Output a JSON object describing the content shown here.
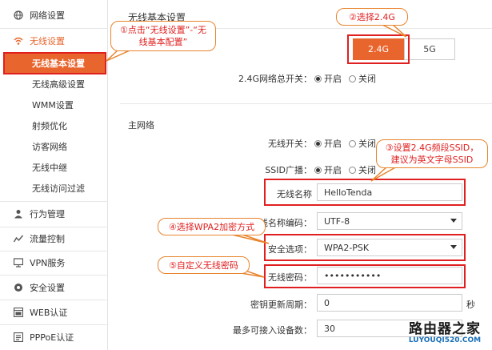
{
  "sidebar": {
    "items": [
      {
        "label": "网络设置",
        "icon": "globe-icon"
      },
      {
        "label": "无线设置",
        "icon": "wifi-icon"
      },
      {
        "label": "行为管理",
        "icon": "user-icon"
      },
      {
        "label": "流量控制",
        "icon": "chart-line-icon"
      },
      {
        "label": "VPN服务",
        "icon": "monitor-icon"
      },
      {
        "label": "安全设置",
        "icon": "shield-gear-icon"
      },
      {
        "label": "WEB认证",
        "icon": "web-auth-icon"
      },
      {
        "label": "PPPoE认证",
        "icon": "pppoe-icon"
      }
    ],
    "sub_items": [
      "无线基本设置",
      "无线高级设置",
      "WMM设置",
      "射频优化",
      "访客网络",
      "无线中继",
      "无线访问过滤"
    ]
  },
  "main": {
    "title": "无线基本设置",
    "bands": [
      "2.4G",
      "5G"
    ],
    "band_switch_label": "2.4G网络总开关：",
    "on_label": "开启",
    "off_label": "关闭",
    "section_title": "主网络",
    "wireless_switch_label": "无线开关：",
    "ssid_broadcast_label": "SSID广播：",
    "name_label": "无线名称",
    "name_value": "HelloTenda",
    "encoding_label": "线名称编码：",
    "encoding_value": "UTF-8",
    "security_label": "安全选项：",
    "security_value": "WPA2-PSK",
    "password_label": "无线密码：",
    "password_value": "•••••••••••",
    "key_period_label": "密钥更新周期：",
    "key_period_value": "0",
    "key_period_unit": "秒",
    "max_devices_label": "最多可接入设备数：",
    "max_devices_value": "30"
  },
  "callouts": {
    "c1": "①点击“无线设置”-“无线基本配置”",
    "c2": "②选择2.4G",
    "c3": "③设置2.4G频段SSID，建议为英文字母SSID",
    "c4": "④选择WPA2加密方式",
    "c5": "⑤自定义无线密码"
  },
  "watermark": {
    "main": "路由器之家",
    "url": "LUYOUQI520.COM"
  },
  "colors": {
    "accent": "#e8652d",
    "highlight": "#e02020",
    "callout_border": "#e8842d",
    "watermark_url": "#1a6fb8"
  }
}
